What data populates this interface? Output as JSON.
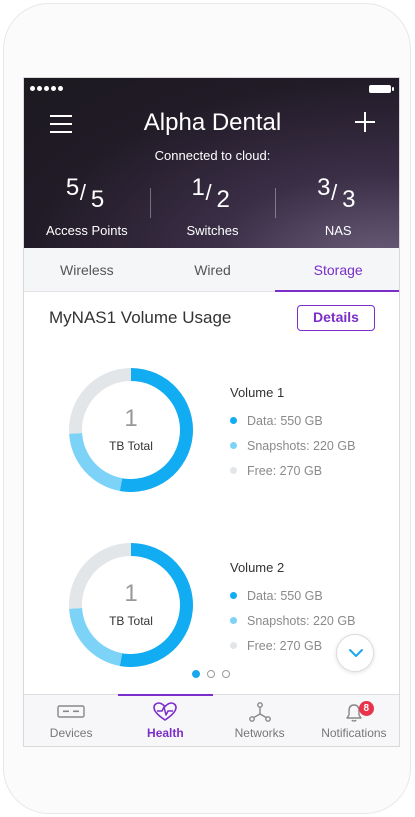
{
  "header": {
    "title": "Alpha Dental",
    "cloud_status": "Connected to cloud:",
    "stats": [
      {
        "num": "5",
        "den": "5",
        "label": "Access Points"
      },
      {
        "num": "1",
        "den": "2",
        "label": "Switches"
      },
      {
        "num": "3",
        "den": "3",
        "label": "NAS"
      }
    ]
  },
  "tabs": [
    {
      "label": "Wireless",
      "active": false
    },
    {
      "label": "Wired",
      "active": false
    },
    {
      "label": "Storage",
      "active": true
    }
  ],
  "volume_usage": {
    "title": "MyNAS1 Volume Usage",
    "details_label": "Details",
    "volumes": [
      {
        "name": "Volume 1",
        "total_num": "1",
        "total_label": "TB Total",
        "items": [
          {
            "label": "Data: 550 GB",
            "value_gb": 550,
            "color": "#12acf2"
          },
          {
            "label": "Snapshots: 220 GB",
            "value_gb": 220,
            "color": "#7dd3f7"
          },
          {
            "label": "Free: 270 GB",
            "value_gb": 270,
            "color": "#e3e6e9"
          }
        ]
      },
      {
        "name": "Volume 2",
        "total_num": "1",
        "total_label": "TB Total",
        "items": [
          {
            "label": "Data: 550 GB",
            "value_gb": 550,
            "color": "#12acf2"
          },
          {
            "label": "Snapshots: 220 GB",
            "value_gb": 220,
            "color": "#7dd3f7"
          },
          {
            "label": "Free: 270 GB",
            "value_gb": 270,
            "color": "#e3e6e9"
          }
        ]
      }
    ],
    "pager": {
      "count": 3,
      "active_index": 0
    }
  },
  "bottom_nav": [
    {
      "label": "Devices",
      "icon": "devices-icon",
      "active": false
    },
    {
      "label": "Health",
      "icon": "health-heart-icon",
      "active": true
    },
    {
      "label": "Networks",
      "icon": "network-icon",
      "active": false
    },
    {
      "label": "Notifications",
      "icon": "bell-icon",
      "active": false,
      "badge": "8"
    }
  ],
  "colors": {
    "accent": "#7b2ec9",
    "data": "#12acf2",
    "snapshots": "#7dd3f7",
    "free": "#e3e6e9",
    "badge": "#e8334a"
  }
}
